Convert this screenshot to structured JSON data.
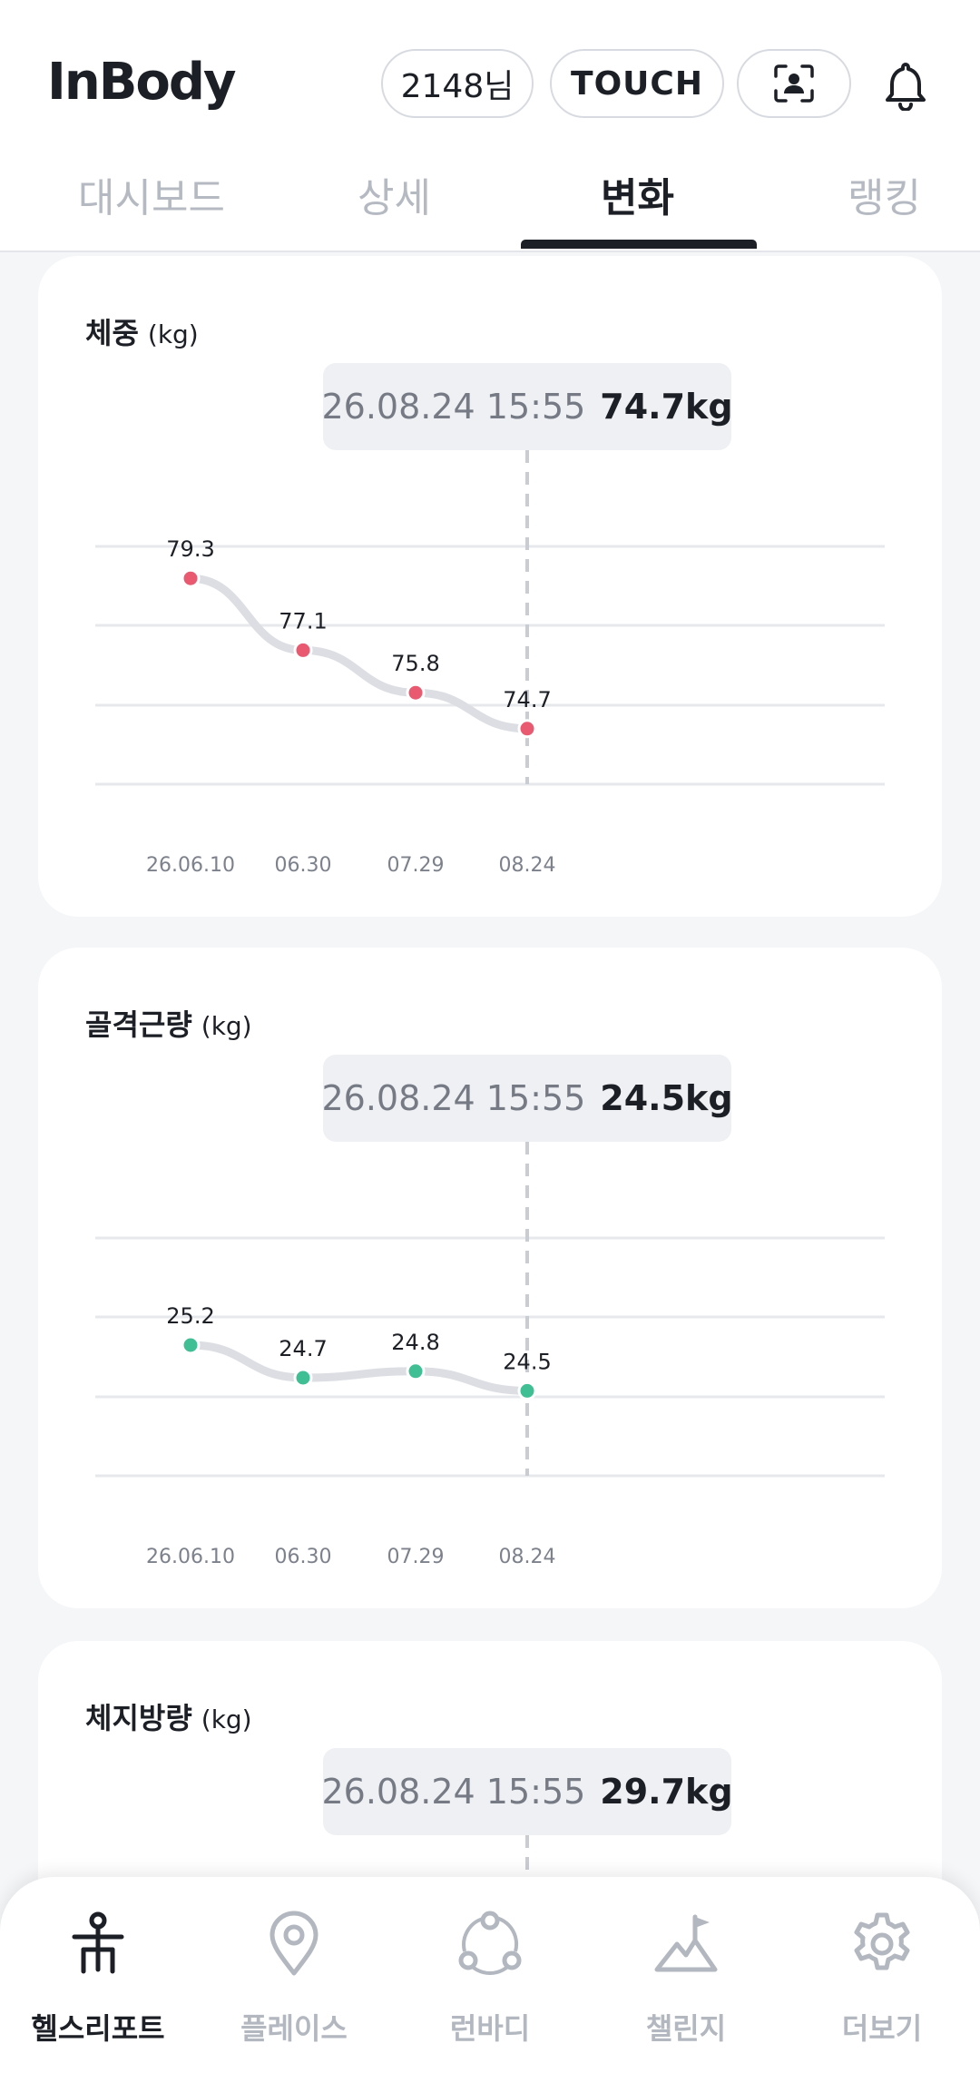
{
  "header": {
    "logo": "InBody",
    "user_label": "2148님",
    "touch_label": "TOUCH",
    "scan_icon": "person-scan-icon",
    "bell_icon": "bell-icon"
  },
  "tabs": [
    {
      "label": "대시보드",
      "active": false
    },
    {
      "label": "상세",
      "active": false
    },
    {
      "label": "변화",
      "active": true
    },
    {
      "label": "랭킹",
      "active": false
    }
  ],
  "cards": [
    {
      "title": "체중",
      "unit": "(kg)",
      "tooltip_date": "26.08.24 15:55",
      "tooltip_value": "74.7kg"
    },
    {
      "title": "골격근량",
      "unit": "(kg)",
      "tooltip_date": "26.08.24 15:55",
      "tooltip_value": "24.5kg"
    },
    {
      "title": "체지방량",
      "unit": "(kg)",
      "tooltip_date": "26.08.24 15:55",
      "tooltip_value": "29.7kg"
    }
  ],
  "chart_data": [
    {
      "type": "line",
      "x": [
        "26.06.10",
        "06.30",
        "07.29",
        "08.24"
      ],
      "values": [
        79.3,
        77.1,
        75.8,
        74.7
      ],
      "value_labels": [
        "79.3",
        "77.1",
        "75.8",
        "74.7"
      ],
      "ylim": [
        73,
        81
      ],
      "color": "#e95a71",
      "selected_index": 3,
      "grid": true
    },
    {
      "type": "line",
      "x": [
        "26.06.10",
        "06.30",
        "07.29",
        "08.24"
      ],
      "values": [
        25.2,
        24.7,
        24.8,
        24.5
      ],
      "value_labels": [
        "25.2",
        "24.7",
        "24.8",
        "24.5"
      ],
      "ylim": [
        23.2,
        27.2
      ],
      "color": "#3fbf93",
      "selected_index": 3,
      "grid": true
    }
  ],
  "bottom_nav": [
    {
      "label": "헬스리포트",
      "icon": "health-report-icon",
      "active": true
    },
    {
      "label": "플레이스",
      "icon": "location-pin-icon",
      "active": false
    },
    {
      "label": "런바디",
      "icon": "run-body-icon",
      "active": false
    },
    {
      "label": "챌린지",
      "icon": "mountain-flag-icon",
      "active": false
    },
    {
      "label": "더보기",
      "icon": "gear-icon",
      "active": false
    }
  ],
  "colors": {
    "accent_dark": "#1c1f26",
    "inactive": "#b2b7c0",
    "weight_dot": "#e95a71",
    "muscle_dot": "#3fbf93"
  }
}
